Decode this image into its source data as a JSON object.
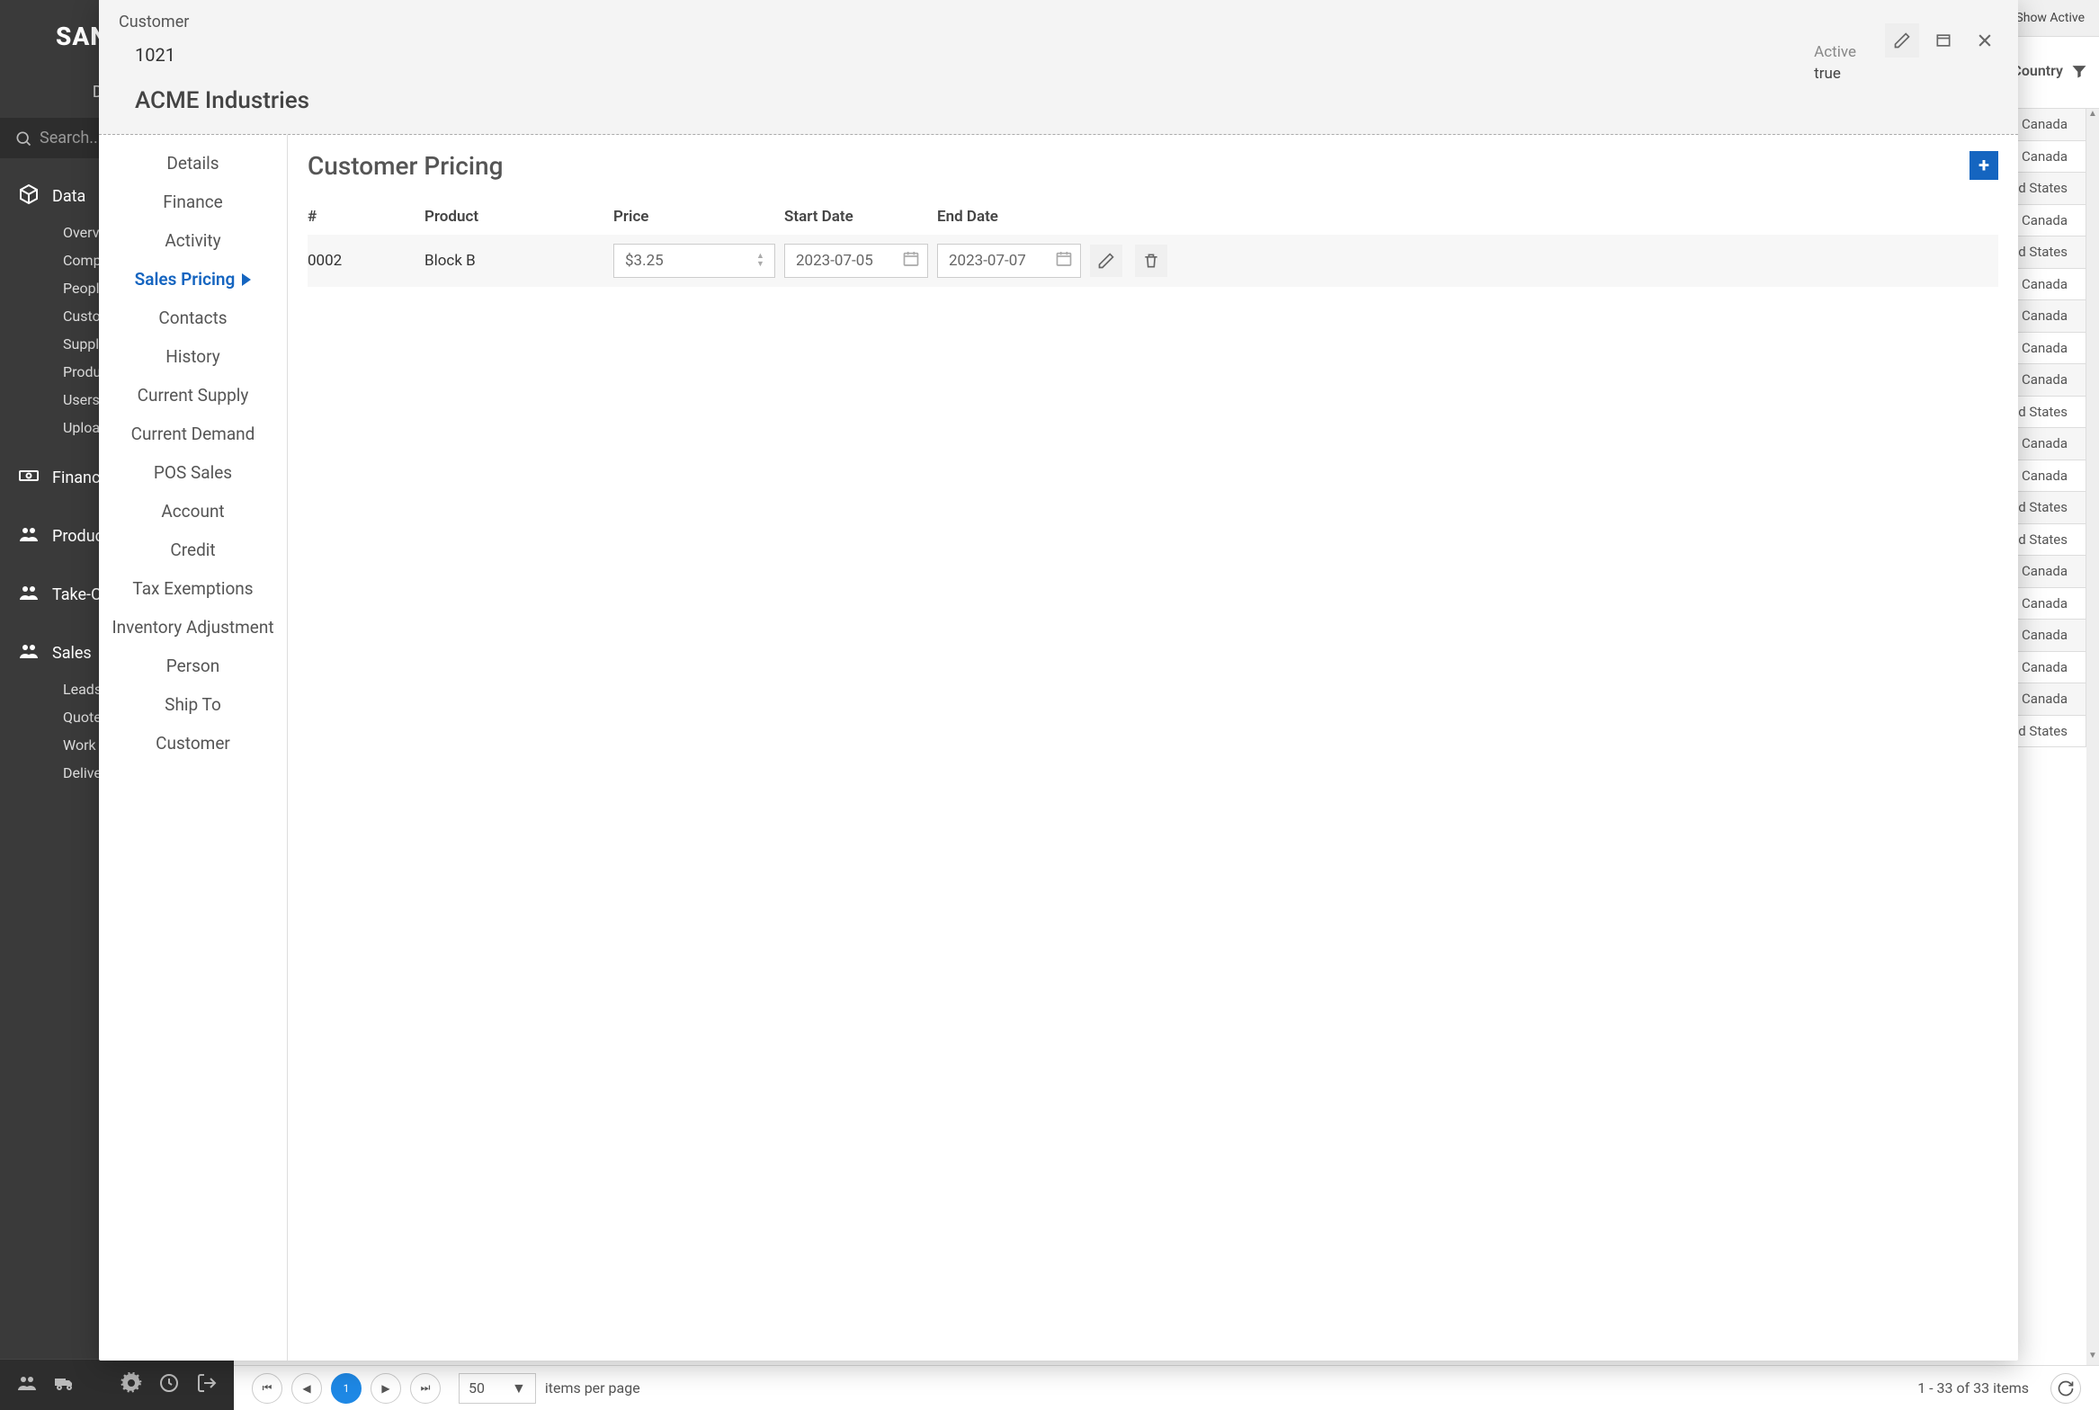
{
  "brand": "SANDBOX",
  "deploy_label": "Deploy",
  "search_placeholder": "Search...",
  "top_bar": {
    "only_show_active": "Only Show Active"
  },
  "sidebar": {
    "groups": [
      {
        "icon": "cube-icon",
        "label": "Data",
        "items": [
          {
            "label": "Overview"
          },
          {
            "label": "Companies"
          },
          {
            "label": "People"
          },
          {
            "label": "Customers",
            "active": true
          },
          {
            "label": "Suppliers"
          },
          {
            "label": "Products"
          },
          {
            "label": "Users"
          },
          {
            "label": "Uploads"
          }
        ]
      },
      {
        "icon": "money-icon",
        "label": "Finance",
        "items": []
      },
      {
        "icon": "people-icon",
        "label": "Production",
        "items": []
      },
      {
        "icon": "people-icon",
        "label": "Take-Orders",
        "items": []
      },
      {
        "icon": "people-icon",
        "label": "Sales",
        "items": [
          {
            "label": "Leads"
          },
          {
            "label": "Quotes"
          },
          {
            "label": "Work"
          },
          {
            "label": "Deliveries"
          }
        ]
      }
    ],
    "footer_icons": [
      "people-icon",
      "truck-icon",
      "gear-icon",
      "clock-icon",
      "logout-icon"
    ]
  },
  "grid": {
    "column_country": "Country",
    "rows_country": [
      "Canada",
      "Canada",
      "United States",
      "Canada",
      "United States",
      "Canada",
      "Canada",
      "Canada",
      "Canada",
      "United States",
      "Canada",
      "Canada",
      "United States",
      "United States",
      "Canada",
      "Canada",
      "Canada",
      "Canada",
      "Canada",
      "United States"
    ]
  },
  "pager": {
    "page": "1",
    "page_size": "50",
    "items_per_page_label": "items per page",
    "summary": "1 - 33 of 33 items"
  },
  "modal": {
    "title": "Customer",
    "customer_id": "1021",
    "customer_name": "ACME Industries",
    "active_label": "Active",
    "active_value": "true",
    "tabs": [
      "Details",
      "Finance",
      "Activity",
      "Sales Pricing",
      "Contacts",
      "History",
      "Current Supply",
      "Current Demand",
      "POS Sales",
      "Account",
      "Credit",
      "Tax Exemptions",
      "Inventory Adjustment",
      "Person",
      "Ship To",
      "Customer"
    ],
    "active_tab_index": 3,
    "content_title": "Customer Pricing",
    "price_table": {
      "columns": {
        "num": "#",
        "product": "Product",
        "price": "Price",
        "start": "Start Date",
        "end": "End Date"
      },
      "rows": [
        {
          "num": "0002",
          "product": "Block B",
          "price": "$3.25",
          "start": "2023-07-05",
          "end": "2023-07-07"
        }
      ]
    }
  }
}
